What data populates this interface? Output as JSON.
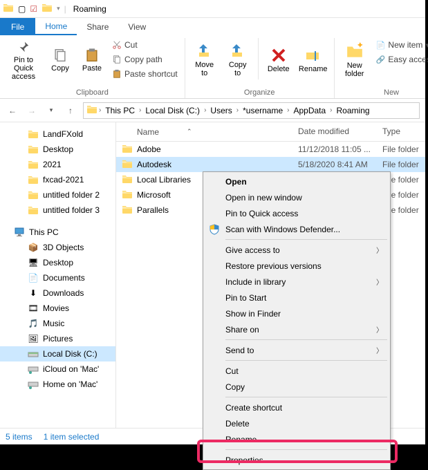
{
  "title": "Roaming",
  "qat": {
    "item1": "▢",
    "item2": "☑",
    "item3": "▢",
    "divider": "|"
  },
  "tabs": {
    "file": "File",
    "home": "Home",
    "share": "Share",
    "view": "View"
  },
  "ribbon": {
    "clipboard": {
      "label": "Clipboard",
      "pin": "Pin to Quick\naccess",
      "copy": "Copy",
      "paste": "Paste",
      "cut": "Cut",
      "copypath": "Copy path",
      "pasteshortcut": "Paste shortcut"
    },
    "organize": {
      "label": "Organize",
      "moveto": "Move\nto",
      "copyto": "Copy\nto",
      "delete": "Delete",
      "rename": "Rename"
    },
    "new": {
      "label": "New",
      "newfolder": "New\nfolder",
      "newitem": "New item",
      "easyaccess": "Easy access"
    }
  },
  "breadcrumbs": [
    "This PC",
    "Local Disk (C:)",
    "Users",
    "*username",
    "AppData",
    "Roaming"
  ],
  "sidebar": {
    "items": [
      {
        "label": "LandFXold",
        "type": "folder"
      },
      {
        "label": "Desktop",
        "type": "folder"
      },
      {
        "label": "2021",
        "type": "folder"
      },
      {
        "label": "fxcad-2021",
        "type": "folder"
      },
      {
        "label": "untitled folder 2",
        "type": "folder"
      },
      {
        "label": "untitled folder 3",
        "type": "folder"
      }
    ],
    "thispc": "This PC",
    "pcitems": [
      {
        "label": "3D Objects"
      },
      {
        "label": "Desktop"
      },
      {
        "label": "Documents"
      },
      {
        "label": "Downloads"
      },
      {
        "label": "Movies"
      },
      {
        "label": "Music"
      },
      {
        "label": "Pictures"
      },
      {
        "label": "Local Disk (C:)",
        "active": true
      },
      {
        "label": "iCloud on 'Mac'"
      },
      {
        "label": "Home on 'Mac'"
      }
    ]
  },
  "columns": {
    "name": "Name",
    "date": "Date modified",
    "type": "Type"
  },
  "files": [
    {
      "name": "Adobe",
      "date": "11/12/2018 11:05 ...",
      "type": "File folder",
      "selected": false
    },
    {
      "name": "Autodesk",
      "date": "5/18/2020 8:41 AM",
      "type": "File folder",
      "selected": true
    },
    {
      "name": "Local Libraries",
      "date": "",
      "type": "File folder",
      "selected": false
    },
    {
      "name": "Microsoft",
      "date": "",
      "type": "File folder",
      "selected": false
    },
    {
      "name": "Parallels",
      "date": "",
      "type": "File folder",
      "selected": false
    }
  ],
  "status": {
    "count": "5 items",
    "selected": "1 item selected"
  },
  "contextmenu": [
    {
      "label": "Open",
      "bold": true
    },
    {
      "label": "Open in new window"
    },
    {
      "label": "Pin to Quick access"
    },
    {
      "label": "Scan with Windows Defender...",
      "icon": "shield"
    },
    {
      "sep": true
    },
    {
      "label": "Give access to",
      "sub": true
    },
    {
      "label": "Restore previous versions"
    },
    {
      "label": "Include in library",
      "sub": true
    },
    {
      "label": "Pin to Start"
    },
    {
      "label": "Show in Finder"
    },
    {
      "label": "Share on",
      "sub": true
    },
    {
      "sep": true
    },
    {
      "label": "Send to",
      "sub": true
    },
    {
      "sep": true
    },
    {
      "label": "Cut"
    },
    {
      "label": "Copy"
    },
    {
      "sep": true
    },
    {
      "label": "Create shortcut"
    },
    {
      "label": "Delete"
    },
    {
      "label": "Rename"
    },
    {
      "sep": true
    },
    {
      "label": "Properties"
    }
  ]
}
